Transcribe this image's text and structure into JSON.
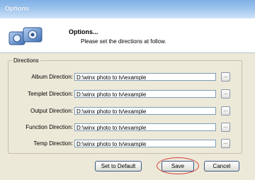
{
  "window": {
    "title": "Options",
    "subtitle": ""
  },
  "header": {
    "title": "Options...",
    "subtitle": "Please set the directions at follow."
  },
  "directions": {
    "group_label": "Directions",
    "rows": [
      {
        "label": "Album Direction:",
        "value": "D:\\winx photo to tv\\example",
        "browse": "..."
      },
      {
        "label": "Templet Direction:",
        "value": "D:\\winx photo to tv\\example",
        "browse": "..."
      },
      {
        "label": "Output Direction:",
        "value": "D:\\winx photo to tv\\example",
        "browse": "..."
      },
      {
        "label": "Function Direction:",
        "value": "D:\\winx photo to tv\\example",
        "browse": "..."
      },
      {
        "label": "Temp Direction:",
        "value": "D:\\winx photo to tv\\example",
        "browse": "..."
      }
    ]
  },
  "buttons": {
    "set_default": "Set to Default",
    "save": "Save",
    "cancel": "Cancel"
  },
  "colors": {
    "annotation": "#d84242"
  }
}
